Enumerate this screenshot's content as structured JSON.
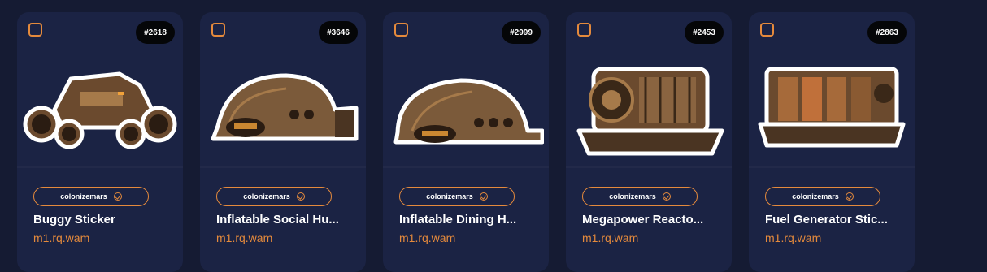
{
  "cards": [
    {
      "badge": "#2618",
      "collection": "colonizemars",
      "title": "Buggy Sticker",
      "owner": "m1.rq.wam",
      "icon": "buggy-sticker-image"
    },
    {
      "badge": "#3646",
      "collection": "colonizemars",
      "title": "Inflatable Social Hu...",
      "owner": "m1.rq.wam",
      "icon": "inflatable-social-hub-image"
    },
    {
      "badge": "#2999",
      "collection": "colonizemars",
      "title": "Inflatable Dining H...",
      "owner": "m1.rq.wam",
      "icon": "inflatable-dining-hall-image"
    },
    {
      "badge": "#2453",
      "collection": "colonizemars",
      "title": "Megapower Reacto...",
      "owner": "m1.rq.wam",
      "icon": "megapower-reactor-image"
    },
    {
      "badge": "#2863",
      "collection": "colonizemars",
      "title": "Fuel Generator Stic...",
      "owner": "m1.rq.wam",
      "icon": "fuel-generator-image"
    }
  ],
  "colors": {
    "background": "#151b33",
    "card": "#1b2344",
    "accent": "#e58a3c",
    "badge": "#050608"
  }
}
